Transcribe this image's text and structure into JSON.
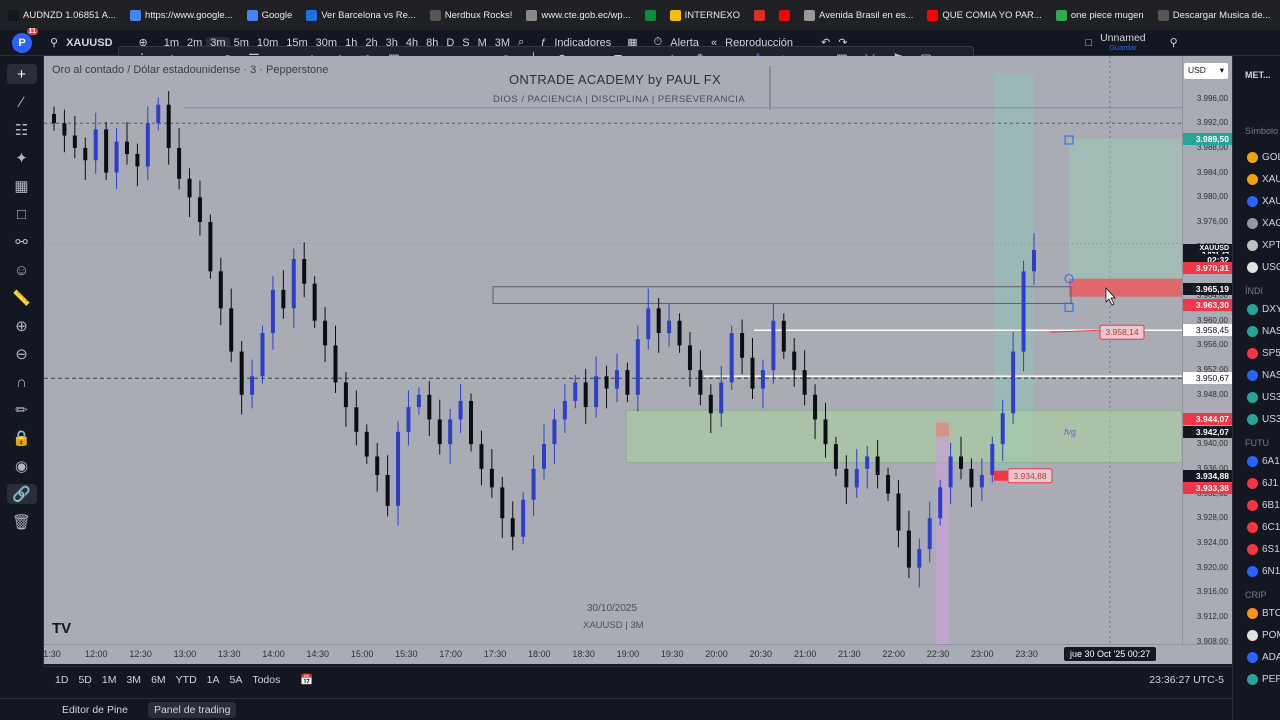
{
  "browser": {
    "bookmarks": [
      {
        "label": "AUDNZD 1.06851 A...",
        "color": "#131722"
      },
      {
        "label": "https://www.google...",
        "color": "#4285f4"
      },
      {
        "label": "Google",
        "color": "#4285f4"
      },
      {
        "label": "Ver Barcelona vs Re...",
        "color": "#1a73e8"
      },
      {
        "label": "Nerdbux Rocks!",
        "color": "#555"
      },
      {
        "label": "www.cte.gob.ec/wp...",
        "color": "#888"
      },
      {
        "label": "",
        "color": "#0a8f3c"
      },
      {
        "label": "INTERNEXO",
        "color": "#fbbc04"
      },
      {
        "label": "",
        "color": "#d93025"
      },
      {
        "label": "",
        "color": "#ff0000"
      },
      {
        "label": "Avenida Brasil en es...",
        "color": "#999"
      },
      {
        "label": "QUE COMIA YO PAR...",
        "color": "#ff0000"
      },
      {
        "label": "one piece mugen",
        "color": "#34a853"
      },
      {
        "label": "Descargar Musica de...",
        "color": "#555"
      }
    ]
  },
  "topbar": {
    "avatar_letter": "P",
    "notif_count": "11",
    "symbol": "XAUUSD",
    "intervals": [
      "1m",
      "2m",
      "3m",
      "5m",
      "10m",
      "15m",
      "30m",
      "1h",
      "2h",
      "3h",
      "4h",
      "8h",
      "D",
      "S",
      "M",
      "3M"
    ],
    "active_interval": "3m",
    "indicators": "Indicadores",
    "alert": "Alerta",
    "replay": "Reproducción",
    "layout_name": "Unnamed",
    "save": "Guardar"
  },
  "chart": {
    "legend": "Oro al contado / Dólar estadounidense · 3 · Pepperstone",
    "academy_title": "ONTRADE ACADEMY by PAUL FX",
    "academy_subtitle": "DIOS / PACIENCIA  |  DISCIPLINA  |  PERSEVERANCIA",
    "watermark_date": "30/10/2025",
    "watermark_symbol": "XAUUSD | 3M",
    "currency": "USD",
    "fvg_label": "fvg",
    "price_ticks": [
      "3.996,00",
      "3.992,00",
      "3.988,00",
      "3.984,00",
      "3.980,00",
      "3.976,00",
      "3.972,00",
      "3.968,00",
      "3.964,00",
      "3.960,00",
      "3.956,00",
      "3.952,00",
      "3.948,00",
      "3.944,00",
      "3.940,00",
      "3.936,00",
      "3.932,00",
      "3.928,00",
      "3.924,00",
      "3.920,00",
      "3.916,00",
      "3.912,00",
      "3.908,00"
    ],
    "price_labels": [
      {
        "text": "3.989,50",
        "price": 3989.5,
        "color": "#26a69a"
      },
      {
        "text": "XAUUSD 3.971,47",
        "price": 3971.47,
        "color": "#131722"
      },
      {
        "text": "02:32",
        "price": 3969.9,
        "color": "#131722"
      },
      {
        "text": "3.970,31",
        "price": 3968.6,
        "color": "#f23645"
      },
      {
        "text": "3.965,19",
        "price": 3965.19,
        "color": "#131722"
      },
      {
        "text": "3.963,30",
        "price": 3962.6,
        "color": "#f23645"
      },
      {
        "text": "3.958,45",
        "price": 3958.45,
        "color": "#ffffff"
      },
      {
        "text": "3.950,67",
        "price": 3950.67,
        "color": "#ffffff"
      },
      {
        "text": "3.944,07",
        "price": 3944.07,
        "color": "#f23645"
      },
      {
        "text": "3.942,07",
        "price": 3941.9,
        "color": "#131722"
      },
      {
        "text": "3.934,88",
        "price": 3934.88,
        "color": "#131722"
      },
      {
        "text": "3.933,38",
        "price": 3932.9,
        "color": "#f23645"
      }
    ],
    "markers": [
      {
        "text": "3.958,14",
        "price": 3958.14
      },
      {
        "text": "3.934,88",
        "price": 3934.88
      }
    ],
    "time_labels": [
      "1:30",
      "12:00",
      "12:30",
      "13:00",
      "13:30",
      "14:00",
      "14:30",
      "15:00",
      "15:30",
      "17:00",
      "17:30",
      "18:00",
      "18:30",
      "19:00",
      "19:30",
      "20:00",
      "20:30",
      "21:00",
      "21:30",
      "22:00",
      "22:30",
      "23:00",
      "23:30",
      "00"
    ],
    "crosshair_time": "jue 30 Oct '25   00:27"
  },
  "chart_data": {
    "type": "candlestick",
    "symbol": "XAUUSD",
    "timeframe": "3m",
    "ylim": [
      3906,
      3999
    ],
    "closes": [
      3992,
      3990,
      3988,
      3986,
      3991,
      3984,
      3989,
      3987,
      3985,
      3992,
      3995,
      3988,
      3983,
      3980,
      3976,
      3968,
      3962,
      3955,
      3948,
      3951,
      3958,
      3965,
      3962,
      3970,
      3966,
      3960,
      3956,
      3950,
      3946,
      3942,
      3938,
      3935,
      3930,
      3942,
      3946,
      3948,
      3944,
      3940,
      3944,
      3947,
      3940,
      3936,
      3933,
      3928,
      3925,
      3931,
      3936,
      3940,
      3944,
      3947,
      3950,
      3946,
      3951,
      3949,
      3952,
      3948,
      3957,
      3962,
      3958,
      3960,
      3956,
      3952,
      3948,
      3945,
      3950,
      3958,
      3954,
      3949,
      3952,
      3960,
      3955,
      3952,
      3948,
      3944,
      3940,
      3936,
      3933,
      3936,
      3938,
      3935,
      3932,
      3926,
      3920,
      3923,
      3928,
      3933,
      3938,
      3936,
      3933,
      3935,
      3940,
      3945,
      3955,
      3968,
      3971.47
    ]
  },
  "rangebar": {
    "ranges": [
      "1D",
      "5D",
      "1M",
      "3M",
      "6M",
      "YTD",
      "1A",
      "5A",
      "Todos"
    ],
    "clock": "23:36:27 UTC-5"
  },
  "footer": {
    "tabs": [
      "Editor de Pine",
      "Panel de trading"
    ],
    "active": "Panel de trading"
  },
  "watchlist": {
    "header": "MET...",
    "section_symbols": "Símbolo",
    "items": [
      {
        "label": "GOL",
        "color": "#f0a30a"
      },
      {
        "label": "XAU",
        "color": "#f0a30a"
      },
      {
        "label": "XAU",
        "color": "#2962ff"
      },
      {
        "label": "XAG",
        "color": "#9598a1"
      },
      {
        "label": "XPT",
        "color": "#c0c0c0"
      },
      {
        "label": "USO",
        "color": "#e0e0e0"
      }
    ],
    "section_indices": "ÍNDI",
    "indices": [
      {
        "label": "DXY",
        "color": "#26a69a"
      },
      {
        "label": "NAS",
        "color": "#26a69a"
      },
      {
        "label": "SP5",
        "color": "#f23645"
      },
      {
        "label": "NAS",
        "color": "#2962ff"
      },
      {
        "label": "US3",
        "color": "#26a69a"
      },
      {
        "label": "US3",
        "color": "#26a69a"
      }
    ],
    "section_futures": "FUTU",
    "futures": [
      {
        "label": "6A1",
        "color": "#2962ff"
      },
      {
        "label": "6J1",
        "color": "#f23645"
      },
      {
        "label": "6B1",
        "color": "#f23645"
      },
      {
        "label": "6C1",
        "color": "#f23645"
      },
      {
        "label": "6S1",
        "color": "#f23645"
      },
      {
        "label": "6N1",
        "color": "#2962ff"
      }
    ],
    "section_crypto": "CRIP",
    "crypto": [
      {
        "label": "BTC",
        "color": "#f7931a"
      },
      {
        "label": "POM",
        "color": "#e0e0e0"
      },
      {
        "label": "ADA",
        "color": "#2962ff"
      },
      {
        "label": "PEP",
        "color": "#26a69a"
      }
    ]
  }
}
